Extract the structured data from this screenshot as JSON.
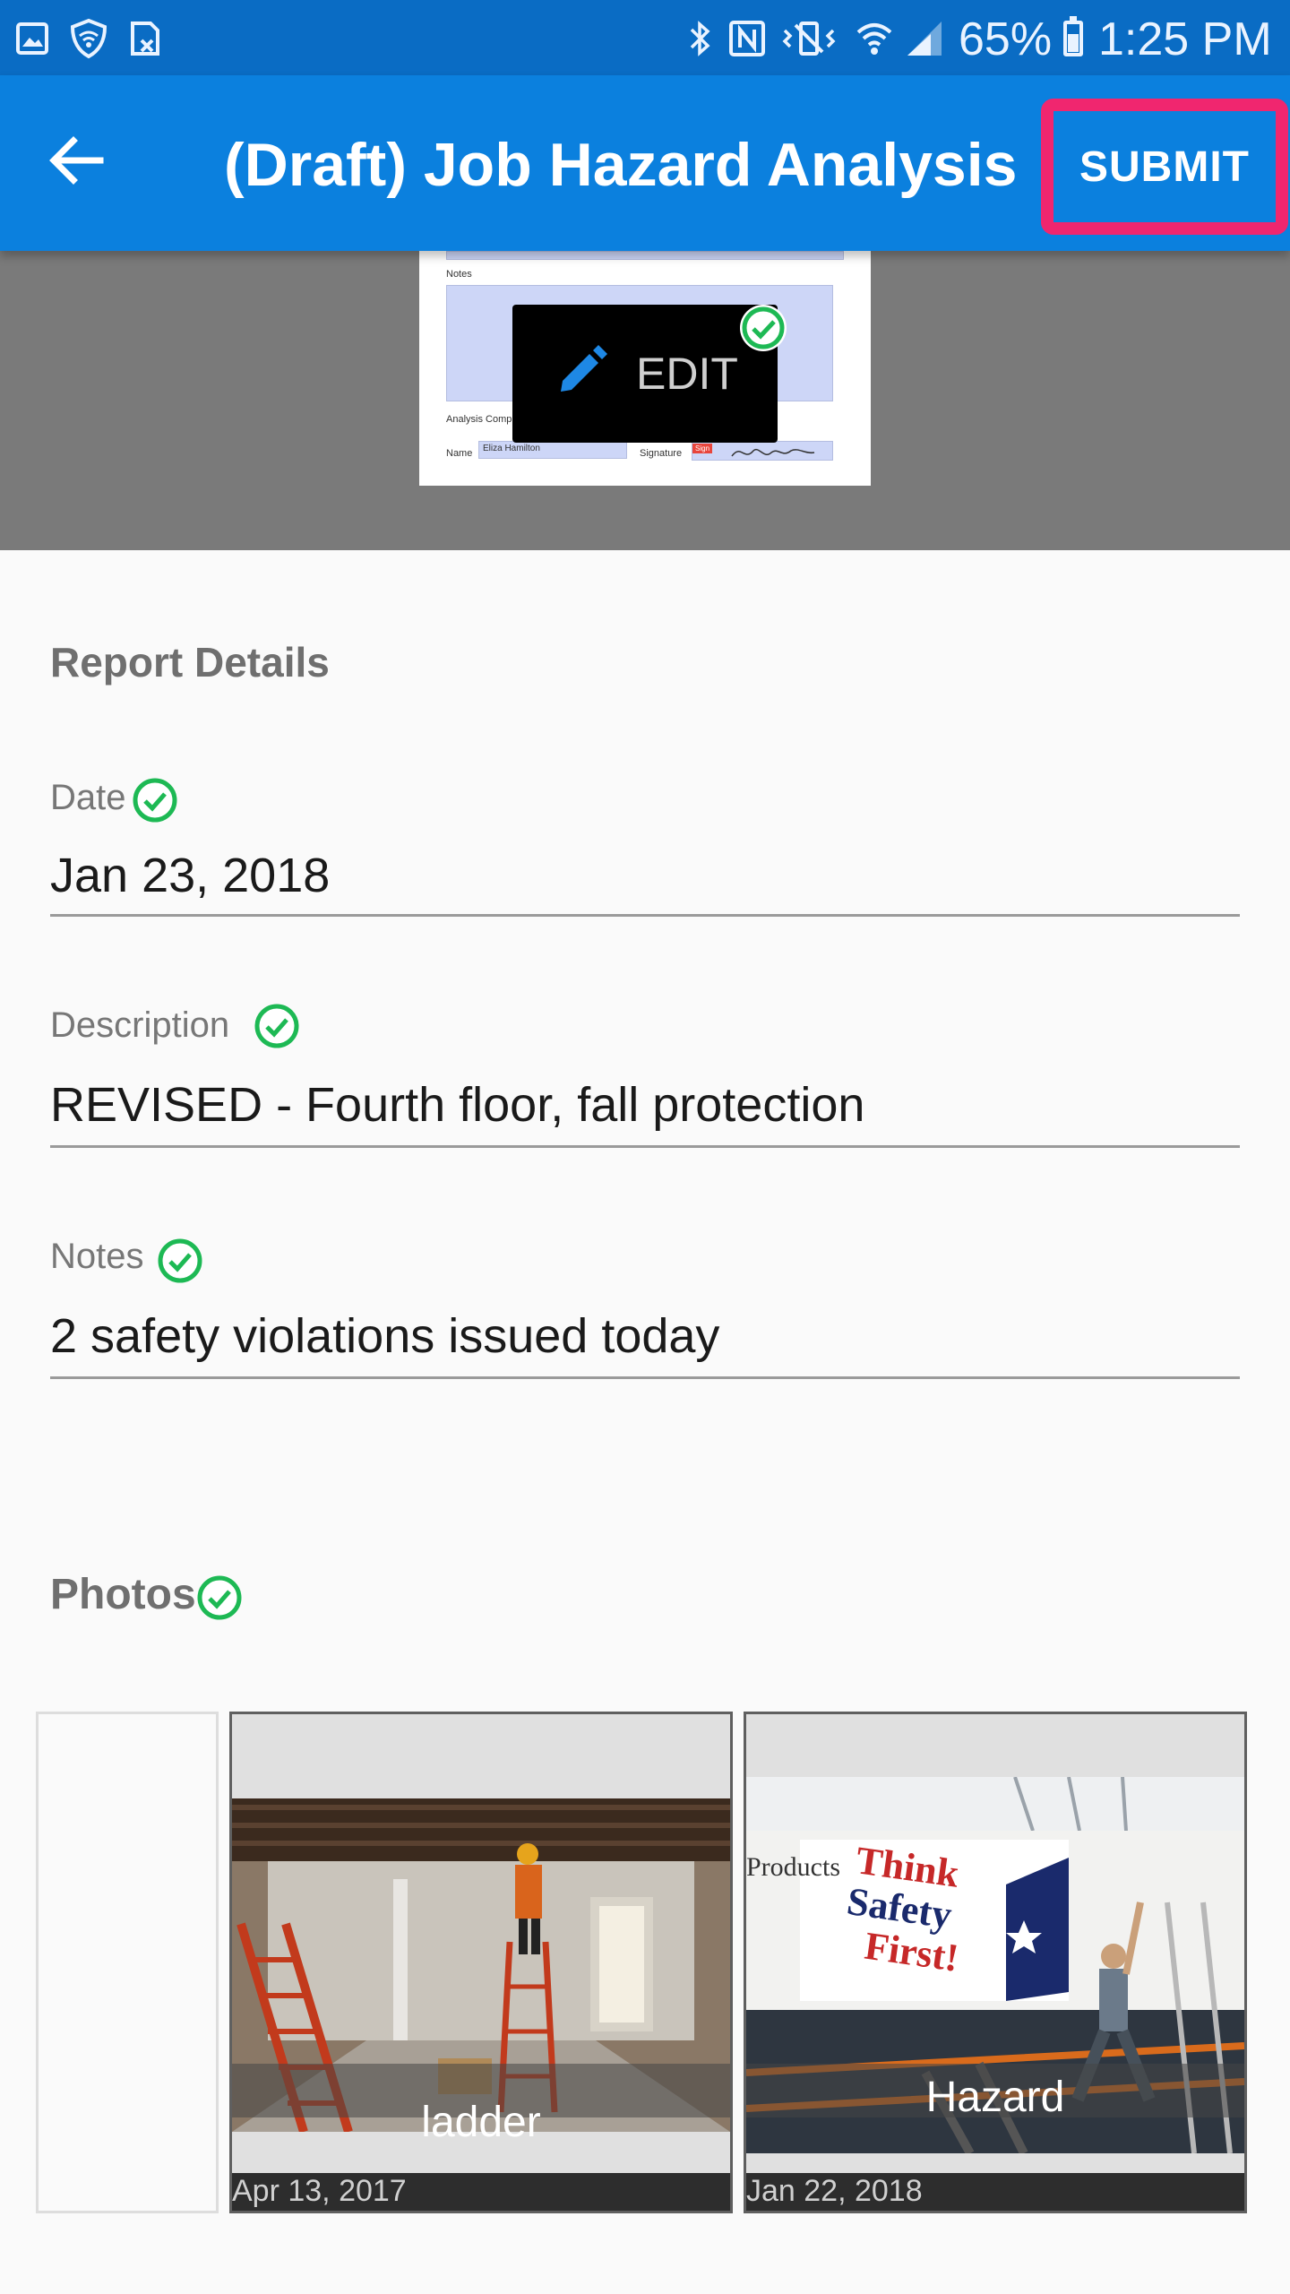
{
  "status_bar": {
    "battery": "65%",
    "time": "1:25 PM",
    "icons": [
      "image-icon",
      "shield-wifi-icon",
      "sim-card-icon",
      "bluetooth-icon",
      "nfc-icon",
      "vibrate-icon",
      "wifi-icon",
      "signal-icon",
      "battery-icon"
    ]
  },
  "app_bar": {
    "title": "(Draft) Job Hazard Analysis",
    "submit_label": "SUBMIT",
    "back_icon": "arrow-back-icon",
    "accent_color": "#0b80de",
    "highlight_color": "#f0266f"
  },
  "preview": {
    "edit_label": "EDIT",
    "doc_notes_label": "Notes",
    "doc_analysis_label": "Analysis Comp",
    "doc_name_label": "Name",
    "doc_name_value": "Eliza Hamilton",
    "doc_signature_label": "Signature",
    "doc_sign_tag": "Sign"
  },
  "report": {
    "section_title": "Report Details",
    "date_label": "Date",
    "date_value": "Jan 23, 2018",
    "description_label": "Description",
    "description_value": "REVISED - Fourth floor, fall protection",
    "notes_label": "Notes",
    "notes_value": "2 safety violations issued today"
  },
  "photos": {
    "section_title": "Photos",
    "items": [
      {
        "caption": "ladder",
        "date": "Apr 13, 2017"
      },
      {
        "caption": "Hazard",
        "date": "Jan 22, 2018",
        "banner_text_1": "Think",
        "banner_text_2": "Safety",
        "banner_text_3": "First!",
        "banner_side": "Products"
      }
    ]
  },
  "colors": {
    "check_green": "#1db954",
    "status_bar": "#0a6cc4"
  }
}
